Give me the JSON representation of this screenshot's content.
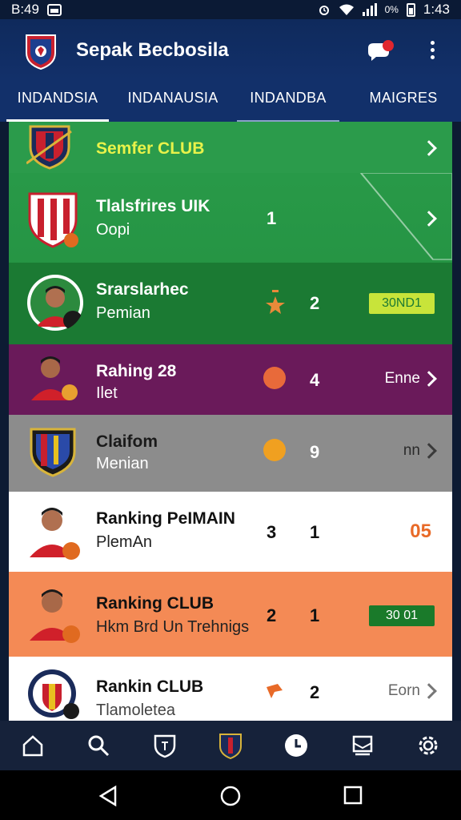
{
  "status": {
    "time_left": "B:49",
    "battery_pct": "0%",
    "time_right": "1:43"
  },
  "app": {
    "title": "Sepak Becbosila"
  },
  "tabs": [
    "INDANDSIA",
    "INDANAUSIA",
    "INDANDBA",
    "MAIGRES"
  ],
  "rows": [
    {
      "name": "Semfer CLUB",
      "sub": "",
      "num1": "",
      "num2": "",
      "trail": ""
    },
    {
      "name": "Tlalsfrires UIK",
      "sub": "Oopi",
      "num1": "1",
      "num2": "",
      "trail": ""
    },
    {
      "name": "Srarslarhec",
      "sub": "Pemian",
      "num1": "",
      "num2": "2",
      "trail": "30ND1"
    },
    {
      "name": "Rahing 28",
      "sub": "Ilet",
      "num1": "",
      "num2": "4",
      "trail": "Enne"
    },
    {
      "name": "Claifom",
      "sub": "Menian",
      "num1": "",
      "num2": "9",
      "trail": "nn"
    },
    {
      "name": "Ranking PeIMAIN",
      "sub": "PlemAn",
      "num1": "3",
      "num2": "1",
      "trail": "05"
    },
    {
      "name": "Ranking CLUB",
      "sub": "Hkm Brd Un Trehnigs",
      "num1": "2",
      "num2": "1",
      "trail": "30 01"
    },
    {
      "name": "Rankin CLUB",
      "sub": "Tlamoletea",
      "num1": "",
      "num2": "2",
      "trail": "Eorn"
    }
  ],
  "colors": {
    "green": "#1f8a3c",
    "green_dark": "#1b7a33",
    "purple": "#6a1a5a",
    "grey": "#8c8c8c",
    "white": "#ffffff",
    "orange": "#f48a55",
    "lime_pill": "#c8e43a",
    "dark_pill": "#1a7a2a"
  },
  "nav_icons": [
    "home-icon",
    "search-icon",
    "shield-icon",
    "club-crest-icon",
    "clock-icon",
    "inbox-icon",
    "settings-icon"
  ]
}
